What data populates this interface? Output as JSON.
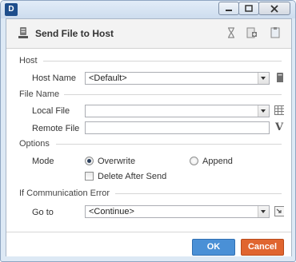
{
  "window": {
    "logo_text": "D"
  },
  "header": {
    "title": "Send File to Host"
  },
  "host": {
    "section_title": "Host",
    "host_name_label": "Host Name",
    "host_name_value": "<Default>"
  },
  "file_name": {
    "section_title": "File Name",
    "local_file_label": "Local File",
    "local_file_value": "",
    "remote_file_label": "Remote File",
    "remote_file_value": "",
    "variable_button": "V"
  },
  "options": {
    "section_title": "Options",
    "mode_label": "Mode",
    "overwrite_label": "Overwrite",
    "append_label": "Append",
    "selected_mode": "Overwrite",
    "delete_after_send_label": "Delete After Send",
    "delete_after_send_checked": false
  },
  "error": {
    "section_title": "If Communication Error",
    "goto_label": "Go to",
    "goto_value": "<Continue>"
  },
  "footer": {
    "ok_label": "OK",
    "cancel_label": "Cancel"
  },
  "colors": {
    "ok": "#4a90d6",
    "cancel": "#e0652f",
    "window_frame": "#dde9f5"
  }
}
